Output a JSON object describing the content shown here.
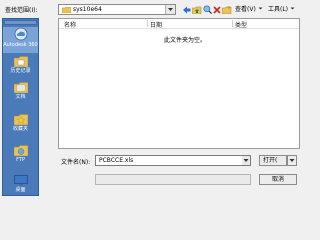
{
  "toolbar": {
    "lookin_label": "查找范围(I):",
    "current_folder": "sys10e64",
    "views_label": "查看(V)",
    "tools_label": "工具(L)"
  },
  "places": [
    {
      "label": "Autodesk 360",
      "icon": "cloud-icon"
    },
    {
      "label": "历史记录",
      "icon": "history-icon"
    },
    {
      "label": "文档",
      "icon": "documents-icon"
    },
    {
      "label": "收藏夹",
      "icon": "favorites-icon"
    },
    {
      "label": "FTP",
      "icon": "ftp-icon"
    },
    {
      "label": "桌面",
      "icon": "desktop-icon"
    }
  ],
  "file_list": {
    "columns": [
      "名称",
      "日期",
      "类型"
    ],
    "empty_message": "此文件夹为空。"
  },
  "filename": {
    "label": "文件名(N):",
    "value": "PCBCCE.xls"
  },
  "buttons": {
    "open": "打开(",
    "cancel": "取消"
  },
  "colors": {
    "places_bg": "#4a7ab8",
    "folder": "#e8c35a"
  }
}
